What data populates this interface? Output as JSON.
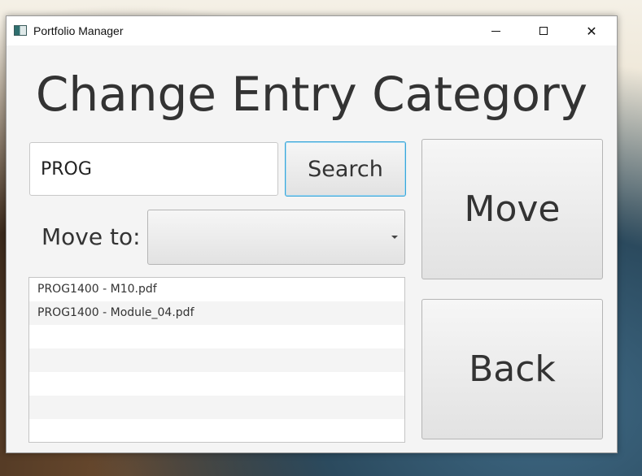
{
  "window": {
    "title": "Portfolio Manager",
    "controls": {
      "minimize": "minimize",
      "maximize": "maximize",
      "close": "✕"
    }
  },
  "heading": "Change Entry Category",
  "search": {
    "value": "PROG",
    "placeholder": "",
    "button_label": "Search"
  },
  "move_to": {
    "label": "Move to:",
    "selected": ""
  },
  "entries": [
    "PROG1400 - M10.pdf",
    "PROG1400 - Module_04.pdf",
    "",
    "",
    "",
    "",
    ""
  ],
  "actions": {
    "move_label": "Move",
    "back_label": "Back"
  },
  "colors": {
    "focus_accent": "#3aa6d8",
    "window_bg": "#f4f4f4"
  }
}
